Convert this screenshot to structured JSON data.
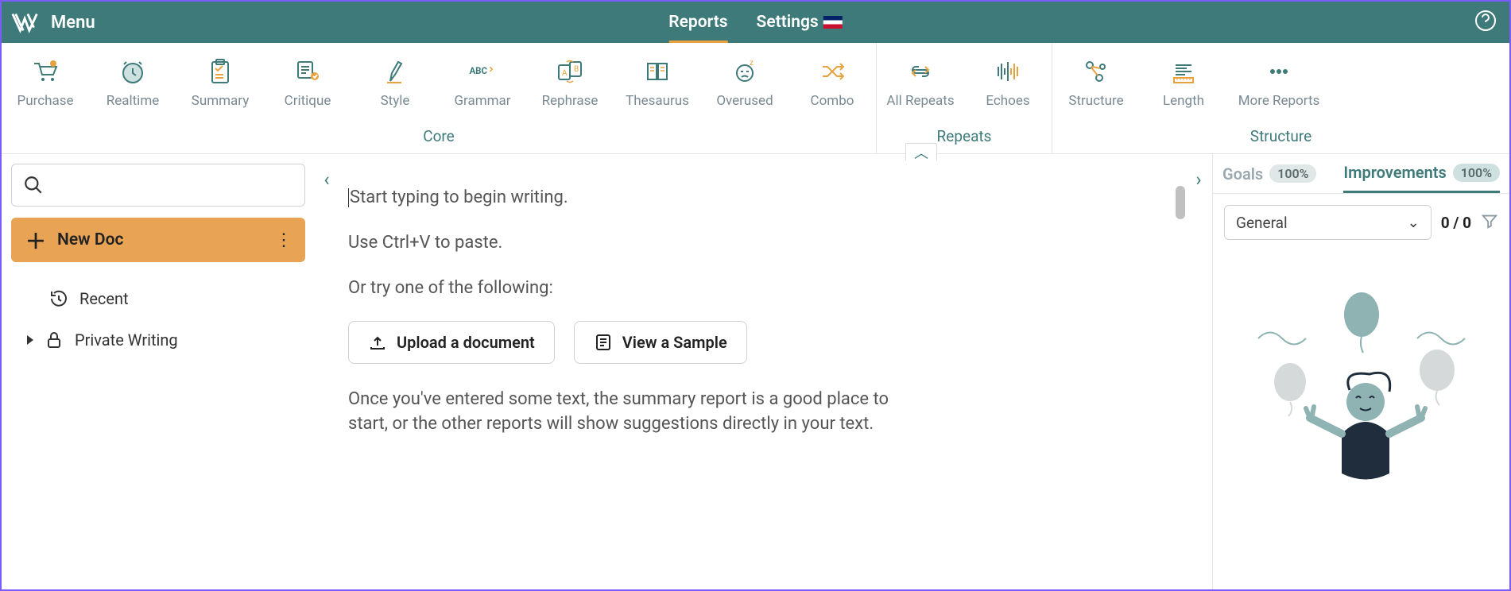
{
  "header": {
    "menu": "Menu",
    "tabs": {
      "reports": "Reports",
      "settings": "Settings"
    }
  },
  "ribbon": {
    "core_label": "Core",
    "repeats_label": "Repeats",
    "structure_label": "Structure",
    "items": {
      "purchase": "Purchase",
      "realtime": "Realtime",
      "summary": "Summary",
      "critique": "Critique",
      "style": "Style",
      "grammar": "Grammar",
      "rephrase": "Rephrase",
      "thesaurus": "Thesaurus",
      "overused": "Overused",
      "combo": "Combo",
      "all_repeats": "All Repeats",
      "echoes": "Echoes",
      "structure": "Structure",
      "length": "Length",
      "more": "More Reports"
    }
  },
  "sidebar": {
    "new_doc": "New Doc",
    "recent": "Recent",
    "private": "Private Writing"
  },
  "editor": {
    "line1": "Start typing to begin writing.",
    "line2": "Use Ctrl+V to paste.",
    "line3": "Or try one of the following:",
    "upload": "Upload a document",
    "sample": "View a Sample",
    "line4": "Once you've entered some text, the summary report is a good place to start, or the other reports will show suggestions directly in your text."
  },
  "panel": {
    "goals": "Goals",
    "goals_pct": "100%",
    "improvements": "Improvements",
    "improvements_pct": "100%",
    "dropdown": "General",
    "count": "0 / 0"
  }
}
